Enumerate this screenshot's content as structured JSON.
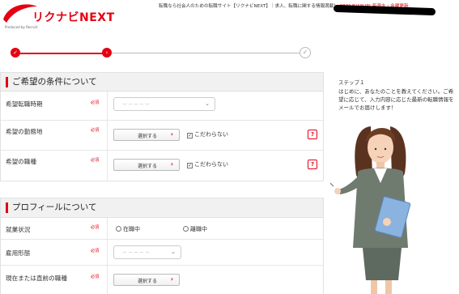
{
  "header": {
    "logo_text": "リクナビNEXT",
    "logo_sub": "Produced by Recruit",
    "tagline": "転職なら社会人のための転職サイト【リクナビNEXT】｜求人、転職に関する情報満載！",
    "updated": "2021/6/18UP! 毎週水・金曜更新"
  },
  "steps": {
    "items": [
      {
        "icon": "check-icon",
        "state": "done"
      },
      {
        "icon": "chevron-right-icon",
        "state": "current"
      },
      {
        "icon": "check-icon",
        "state": "pending"
      }
    ]
  },
  "section1": {
    "title": "ご希望の条件について",
    "rows": {
      "timing": {
        "label": "希望転職時期",
        "required": "必須",
        "placeholder": "－－－－－"
      },
      "location": {
        "label": "希望の勤務地",
        "required": "必須",
        "button": "選択する",
        "checkbox": "こだわらない",
        "help": "?"
      },
      "job": {
        "label": "希望の職種",
        "required": "必須",
        "button": "選択する",
        "checkbox": "こだわらない",
        "help": "?"
      }
    }
  },
  "section2": {
    "title": "プロフィールについて",
    "rows": {
      "employment": {
        "label": "就業状況",
        "required": "必須",
        "option1": "在職中",
        "option2": "離職中"
      },
      "type": {
        "label": "雇用形態",
        "required": "必須",
        "placeholder": "－－－－－"
      },
      "current_job": {
        "label": "現在または直前の職種",
        "required": "必須",
        "button": "選択する"
      }
    }
  },
  "sidebar": {
    "step_label": "ステップ１",
    "description": "はじめに、あなたのことを教えてください。ご希望に応じて、入力内容に応じた最新の転職情報をメールでお届けします！"
  },
  "colors": {
    "accent": "#e50012",
    "section_bg": "#f1f1f1"
  }
}
